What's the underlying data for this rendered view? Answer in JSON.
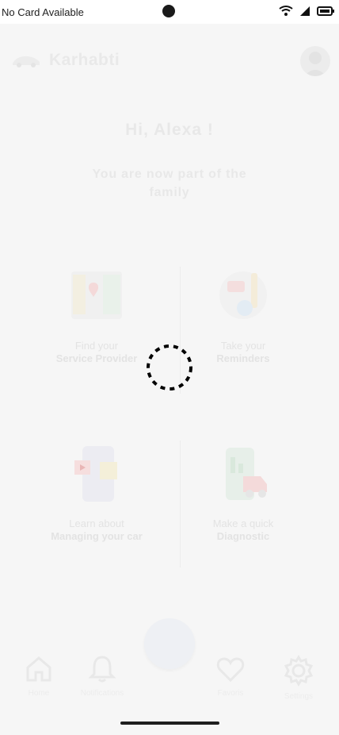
{
  "status_bar": {
    "carrier": "No Card Available",
    "icons": [
      "wifi-icon",
      "signal-icon",
      "battery-icon"
    ]
  },
  "header": {
    "app_name": "Karhabti"
  },
  "greeting": "Hi, Alexa !",
  "subtitle": "You are now part of the family",
  "cards": [
    {
      "line1": "Find your",
      "line2": "Service Provider",
      "icon": "map-icon"
    },
    {
      "line1": "Take your",
      "line2": "Reminders",
      "icon": "reminders-icon"
    },
    {
      "line1": "Learn about",
      "line2": "Managing your car",
      "icon": "phone-video-icon"
    },
    {
      "line1": "Make a quick",
      "line2": "Diagnostic",
      "icon": "diagnostic-icon"
    }
  ],
  "nav": {
    "home": "Home",
    "notifications": "Notifications",
    "favoris": "Favoris",
    "settings": "Settings"
  },
  "colors": {
    "faded": "#e8e8e8",
    "spinner": "#000000"
  }
}
